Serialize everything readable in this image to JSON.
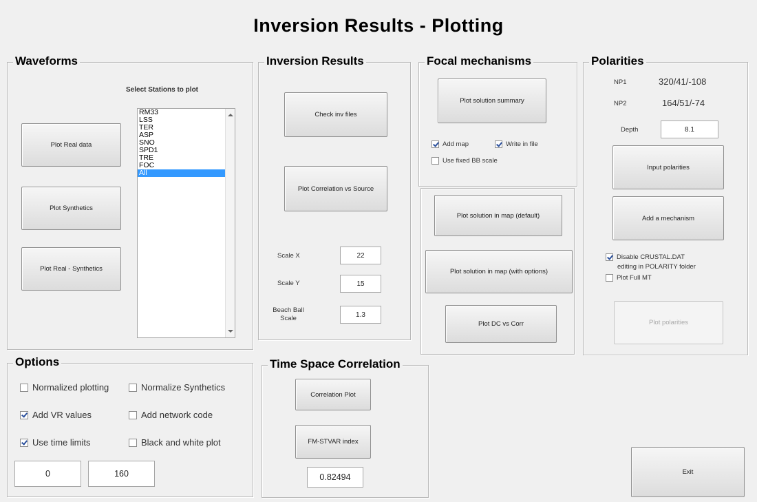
{
  "title": "Inversion Results  -  Plotting",
  "waveforms": {
    "title": "Waveforms",
    "select_label": "Select Stations to plot",
    "stations": [
      "RM33",
      "LSS",
      "TER",
      "ASP",
      "SNO",
      "SPD1",
      "TRE",
      "FOC",
      "All"
    ],
    "selected_station": "All",
    "plot_real_label": "Plot Real data",
    "plot_synth_label": "Plot Synthetics",
    "plot_real_synth_label": "Plot Real - Synthetics"
  },
  "inversion_results": {
    "title": "Inversion Results",
    "check_inv_label": "Check inv files",
    "plot_corr_label": "Plot Correlation vs Source",
    "scale_x_label": "Scale X",
    "scale_x_value": "22",
    "scale_y_label": "Scale Y",
    "scale_y_value": "15",
    "bb_scale_label": "Beach Ball Scale",
    "bb_scale_value": "1.3"
  },
  "focal": {
    "title": "Focal mechanisms",
    "plot_summary_label": "Plot solution summary",
    "add_map_label": "Add map",
    "add_map_checked": true,
    "write_file_label": "Write in file",
    "write_file_checked": true,
    "fixed_bb_label": "Use fixed BB scale",
    "fixed_bb_checked": false,
    "plot_map_default_label": "Plot solution in map (default)",
    "plot_map_options_label": "Plot solution in map (with options)",
    "plot_dc_corr_label": "Plot DC vs Corr"
  },
  "polarities": {
    "title": "Polarities",
    "np1_label": "NP1",
    "np1_value": "320/41/-108",
    "np2_label": "NP2",
    "np2_value": "164/51/-74",
    "depth_label": "Depth",
    "depth_value": "8.1",
    "input_polarities_label": "Input  polarities",
    "add_mechanism_label": "Add a mechanism",
    "disable_crustal_label": "Disable CRUSTAL.DAT",
    "disable_crustal_label2": "editing in POLARITY folder",
    "disable_crustal_checked": true,
    "plot_full_mt_label": "Plot Full MT",
    "plot_full_mt_checked": false,
    "plot_polarities_label": "Plot polarities"
  },
  "options": {
    "title": "Options",
    "normalized_plotting_label": "Normalized plotting",
    "normalized_plotting_checked": false,
    "normalize_synth_label": "Normalize Synthetics",
    "normalize_synth_checked": false,
    "add_vr_label": "Add VR values",
    "add_vr_checked": true,
    "add_network_label": "Add network code",
    "add_network_checked": false,
    "use_time_limits_label": "Use time limits",
    "use_time_limits_checked": true,
    "bw_plot_label": "Black and white plot",
    "bw_plot_checked": false,
    "time_min": "0",
    "time_max": "160"
  },
  "time_space": {
    "title": "Time Space Correlation",
    "correlation_plot_label": "Correlation Plot",
    "fm_stvar_label": "FM-STVAR index",
    "index_value": "0.82494"
  },
  "exit_label": "Exit"
}
